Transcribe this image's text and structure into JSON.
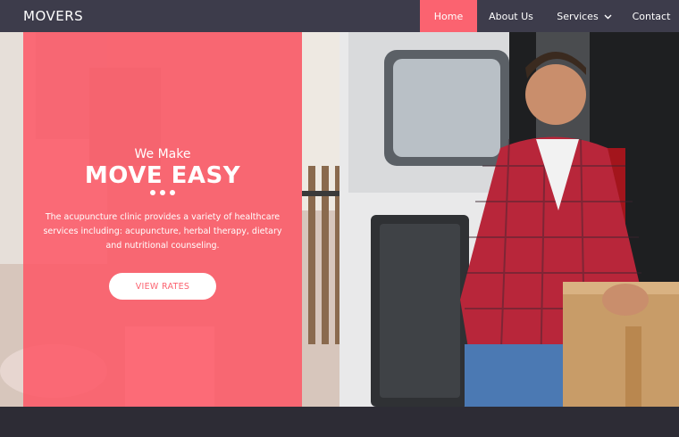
{
  "brand": {
    "name": "MOVERS"
  },
  "nav": {
    "items": [
      {
        "label": "Home",
        "active": true
      },
      {
        "label": "About Us",
        "active": false
      },
      {
        "label": "Services",
        "active": false,
        "has_dropdown": true
      },
      {
        "label": "Contact",
        "active": false
      }
    ]
  },
  "hero": {
    "kicker": "We Make",
    "title": "MOVE EASY",
    "description": "The acupuncture clinic provides a variety of healthcare services including: acupuncture, herbal therapy, dietary and nutritional counseling.",
    "cta_label": "VIEW RATES"
  },
  "colors": {
    "nav_bg": "#3d3c4b",
    "accent": "#fb6370",
    "overlay": "#fd5a68",
    "footer": "#2d2c35"
  },
  "icons": {
    "services_dropdown": "chevron-down-icon"
  }
}
